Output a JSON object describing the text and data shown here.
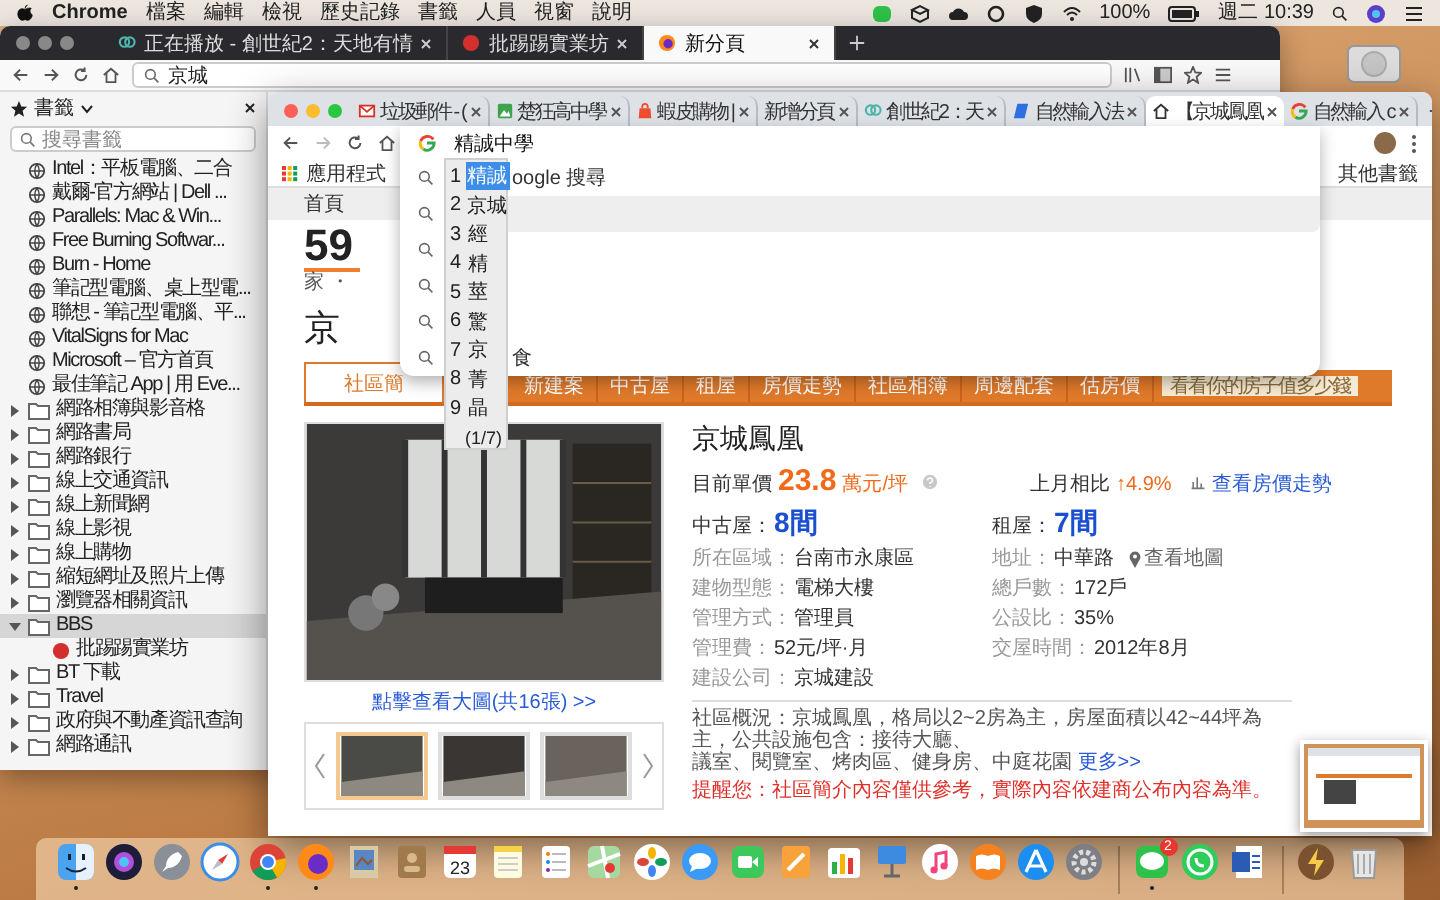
{
  "menu_bar": {
    "app": "Chrome",
    "menus": [
      "檔案",
      "編輯",
      "檢視",
      "歷史記錄",
      "書籤",
      "人員",
      "視窗",
      "說明"
    ],
    "battery": "100%",
    "clock": "週二 10:39"
  },
  "back_window": {
    "tabs": [
      {
        "title": "正在播放 - 創世紀2：天地有情",
        "selected": false
      },
      {
        "title": "批踢踢實業坊",
        "selected": false
      },
      {
        "title": "新分頁",
        "selected": true
      }
    ],
    "address": "京城",
    "sidebar": {
      "title": "書籤",
      "search_placeholder": "搜尋書籤",
      "links": [
        "Intel：平板電腦、二合",
        "戴爾-官方網站 | Dell ...",
        "Parallels: Mac & Win...",
        "Free Burning Softwar...",
        "Burn - Home",
        "筆記型電腦、桌上型電...",
        "聯想 - 筆記型電腦、平...",
        "VitalSigns for Mac",
        "Microsoft – 官方首頁",
        "最佳筆記 App | 用 Eve..."
      ],
      "folders": [
        {
          "name": "網路相簿與影音格",
          "expanded": false,
          "selected": false
        },
        {
          "name": "網路書局",
          "expanded": false,
          "selected": false
        },
        {
          "name": "網路銀行",
          "expanded": false,
          "selected": false
        },
        {
          "name": "線上交通資訊",
          "expanded": false,
          "selected": false
        },
        {
          "name": "線上新聞網",
          "expanded": false,
          "selected": false
        },
        {
          "name": "線上影視",
          "expanded": false,
          "selected": false
        },
        {
          "name": "線上購物",
          "expanded": false,
          "selected": false
        },
        {
          "name": "縮短網址及照片上傳",
          "expanded": false,
          "selected": false
        },
        {
          "name": "瀏覽器相關資訊",
          "expanded": false,
          "selected": false
        },
        {
          "name": "BBS",
          "expanded": true,
          "selected": true,
          "children": [
            {
              "name": "批踢踢實業坊"
            }
          ]
        },
        {
          "name": "BT 下載",
          "expanded": false,
          "selected": false
        },
        {
          "name": "Travel",
          "expanded": false,
          "selected": false
        },
        {
          "name": "政府與不動產資訊查詢",
          "expanded": false,
          "selected": false
        },
        {
          "name": "網路通訊",
          "expanded": false,
          "selected": false
        }
      ]
    }
  },
  "front_window": {
    "tabs": [
      {
        "title": "垃圾郵件 - (",
        "selected": false
      },
      {
        "title": "楚狂高中學",
        "selected": false
      },
      {
        "title": "蝦皮購物 |",
        "selected": false
      },
      {
        "title": "新增分頁",
        "selected": false
      },
      {
        "title": "創世紀2：天",
        "selected": false
      },
      {
        "title": "自然輸入法",
        "selected": false
      },
      {
        "title": "【京城鳳凰",
        "selected": true
      },
      {
        "title": "自然輸入 c",
        "selected": false
      }
    ],
    "omnibox": {
      "value": "精誠中學",
      "suggestions": [
        {
          "text": "oogle 搜尋",
          "selected": false
        },
        {
          "selected": true
        },
        {
          "selected": false
        },
        {
          "selected": false
        },
        {
          "selected": false
        },
        {
          "text": "食",
          "selected": false
        }
      ]
    },
    "ime": {
      "candidates": [
        {
          "number": "1",
          "label": "精誠",
          "selected": true
        },
        {
          "number": "2",
          "label": "京城",
          "selected": false
        },
        {
          "number": "3",
          "label": "經",
          "selected": false
        },
        {
          "number": "4",
          "label": "精",
          "selected": false
        },
        {
          "number": "5",
          "label": "莖",
          "selected": false
        },
        {
          "number": "6",
          "label": "驚",
          "selected": false
        },
        {
          "number": "7",
          "label": "京",
          "selected": false
        },
        {
          "number": "8",
          "label": "菁",
          "selected": false
        },
        {
          "number": "9",
          "label": "晶",
          "selected": false
        }
      ],
      "page": "(1/7)"
    },
    "bookmarks_bar": {
      "apps": "應用程式",
      "other": "其他書籤"
    },
    "page": {
      "home": "首頁",
      "logo": "59",
      "logo_tagline": "家 ・",
      "title": "京",
      "nav": [
        {
          "label": "社區簡",
          "selected": true
        },
        {
          "label": "新建案",
          "selected": false
        },
        {
          "label": "中古屋",
          "selected": false
        },
        {
          "label": "租屋",
          "selected": false
        },
        {
          "label": "房價走勢",
          "selected": false
        },
        {
          "label": "社區相簿",
          "selected": false
        },
        {
          "label": "周邊配套",
          "selected": false
        },
        {
          "label": "估房價",
          "selected": false
        }
      ],
      "promo": "看看你的房子值多少錢",
      "photo_caption": "點擊查看大圖(共16張) >>",
      "thumbnails": [
        {
          "selected": true
        },
        {
          "selected": false
        },
        {
          "selected": false
        }
      ],
      "name": "京城鳳凰",
      "price_label": "目前單價",
      "price": "23.8",
      "price_unit": "萬元/坪",
      "change_label": "上月相比",
      "change": "↑4.9%",
      "trend_link": "查看房價走勢",
      "counts": [
        {
          "label": "中古屋：",
          "value": "8間"
        },
        {
          "label": "租屋：",
          "value": "7間"
        }
      ],
      "details": [
        {
          "label": "所在區域：",
          "value": "台南市永康區"
        },
        {
          "label": "地址：",
          "value": "中華路",
          "link": "查看地圖"
        },
        {
          "label": "建物型態：",
          "value": "電梯大樓"
        },
        {
          "label": "總戶數：",
          "value": "172戶"
        },
        {
          "label": "管理方式：",
          "value": "管理員"
        },
        {
          "label": "公設比：",
          "value": "35%"
        },
        {
          "label": "管理費：",
          "value": "52元/坪·月"
        },
        {
          "label": "交屋時間：",
          "value": "2012年8月"
        },
        {
          "label": "建設公司：",
          "value": "京城建設"
        }
      ],
      "overview_lines": [
        "社區概況：京城鳳凰，格局以2~2房為主，房屋面積以42~44坪為主，公共設施包含：接待大廳、",
        "議室、閱覽室、烤肉區、健身房、中庭花園"
      ],
      "more_link": "更多>>",
      "notice": "提醒您：社區簡介內容僅供參考，實際內容依建商公布內容為準。"
    }
  },
  "dock": {
    "apps": [
      {
        "kind": "finder",
        "running": true
      },
      {
        "kind": "siri",
        "running": false
      },
      {
        "kind": "launchpad",
        "running": false
      },
      {
        "kind": "safari",
        "running": false
      },
      {
        "kind": "chrome",
        "running": true
      },
      {
        "kind": "firefox",
        "running": true
      },
      {
        "kind": "preview",
        "running": false
      },
      {
        "kind": "contacts",
        "running": false
      },
      {
        "kind": "calendar",
        "label": "23",
        "running": false
      },
      {
        "kind": "notes",
        "running": false
      },
      {
        "kind": "reminders",
        "running": false
      },
      {
        "kind": "maps",
        "running": false
      },
      {
        "kind": "photos",
        "running": false
      },
      {
        "kind": "messages",
        "running": false
      },
      {
        "kind": "facetime",
        "running": false
      },
      {
        "kind": "pages",
        "running": false
      },
      {
        "kind": "numbers",
        "running": false
      },
      {
        "kind": "keynote",
        "running": false
      },
      {
        "kind": "music",
        "running": false
      },
      {
        "kind": "books",
        "running": false
      },
      {
        "kind": "appstore",
        "running": false
      },
      {
        "kind": "settings",
        "running": false
      },
      {
        "kind": "separator"
      },
      {
        "kind": "line",
        "badge": "2",
        "running": true
      },
      {
        "kind": "whatsapp",
        "running": false
      },
      {
        "kind": "word",
        "running": false
      },
      {
        "kind": "separator"
      },
      {
        "kind": "lightning",
        "running": false
      },
      {
        "kind": "trash",
        "running": false
      }
    ]
  }
}
